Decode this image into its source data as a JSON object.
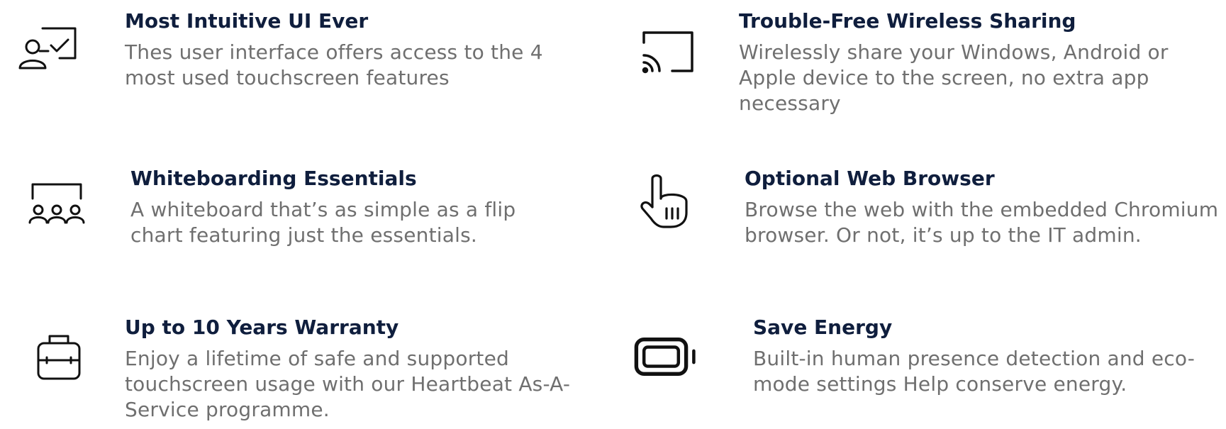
{
  "features": [
    {
      "icon": "presenter-board-icon",
      "title": "Most Intuitive UI Ever",
      "description": "Thes user interface offers access to the 4 most used touchscreen features"
    },
    {
      "icon": "cast-icon",
      "title": "Trouble-Free Wireless Sharing",
      "description": "Wirelessly share your Windows, Android or Apple device to the screen, no extra app necessary"
    },
    {
      "icon": "group-whiteboard-icon",
      "title": "Whiteboarding Essentials",
      "description": "A whiteboard that’s as simple as a flip chart featuring just the essentials."
    },
    {
      "icon": "touch-hand-icon",
      "title": "Optional Web Browser",
      "description": "Browse the web with the embedded Chromium browser. Or not, it’s up to the IT admin."
    },
    {
      "icon": "toolbox-icon",
      "title": "Up to 10 Years Warranty",
      "description": "Enjoy a lifetime of safe and supported touchscreen usage with our Heartbeat As-A-Service programme."
    },
    {
      "icon": "battery-icon",
      "title": "Save Energy",
      "description": "Built-in human presence detection and eco-mode settings Help conserve energy."
    }
  ],
  "colors": {
    "title": "#0f1e3d",
    "description": "#6f6f6f",
    "icon": "#111111",
    "background": "#ffffff"
  }
}
